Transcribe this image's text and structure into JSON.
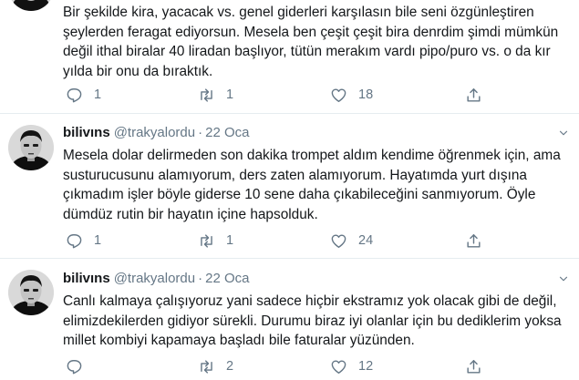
{
  "tweets": [
    {
      "text_lines": [
        "Bir şekilde kira, yacacak vs. genel giderleri karşılasın bile seni özgünleştiren",
        "şeylerden feragat ediyorsun. Mesela ben çeşit çeşit bira denrdim şimdi mümkün",
        "değil ithal biralar 40 liradan başlıyor, tütün merakım vardı pipo/puro vs. o da kır",
        "yılda bir onu da bıraktık."
      ],
      "replies": "1",
      "retweets": "1",
      "likes": "18"
    },
    {
      "display_name": "bilivıns",
      "handle": "@trakyalordu",
      "separator": "·",
      "date": "22 Oca",
      "text_lines": [
        "Mesela dolar delirmeden son dakika trompet aldım kendime öğrenmek için, ama",
        "susturucusunu alamıyorum, ders zaten alamıyorum. Hayatımda yurt dışına",
        "çıkmadım işler böyle giderse 10 sene daha çıkabileceğini sanmıyorum. Öyle",
        "dümdüz rutin bir hayatın içine hapsolduk."
      ],
      "replies": "1",
      "retweets": "1",
      "likes": "24"
    },
    {
      "display_name": "bilivıns",
      "handle": "@trakyalordu",
      "separator": "·",
      "date": "22 Oca",
      "text_lines": [
        "Canlı kalmaya çalışıyoruz yani sadece hiçbir ekstramız yok olacak gibi de değil,",
        "elimizdekilerden gidiyor sürekli. Durumu biraz iyi olanlar için bu dediklerim yoksa",
        "millet kombiyi kapamaya başladı bile  faturalar yüzünden."
      ],
      "replies": "",
      "retweets": "2",
      "likes": "12"
    }
  ],
  "colors": {
    "text": "#14171a",
    "secondary": "#657786",
    "divider": "#e6ecf0"
  },
  "icons": [
    "reply-icon",
    "retweet-icon",
    "like-icon",
    "share-icon",
    "chevron-down-icon",
    "avatar-image"
  ]
}
